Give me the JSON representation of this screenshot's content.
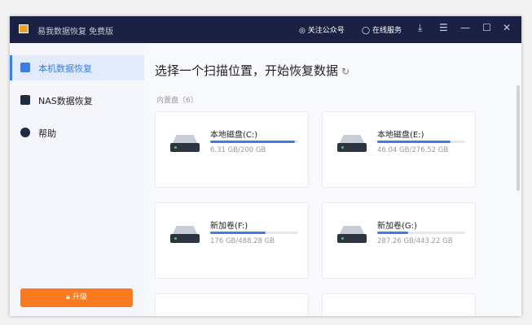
{
  "titlebar": {
    "app_title": "易我数据恢复 免费版",
    "follow": "关注公众号",
    "service": "在线服务"
  },
  "sidebar": {
    "items": [
      {
        "label": "本机数据恢复"
      },
      {
        "label": "NAS数据恢复"
      },
      {
        "label": "帮助"
      }
    ],
    "upgrade": "升级"
  },
  "main": {
    "title": "选择一个扫描位置，开始恢复数据",
    "section": "内置盘（6）",
    "drives": [
      {
        "name": "本地磁盘(C:)",
        "size": "6.31 GB/200 GB",
        "fill": 0.96
      },
      {
        "name": "本地磁盘(E:)",
        "size": "46.04 GB/276.52 GB",
        "fill": 0.83
      },
      {
        "name": "新加卷(F:)",
        "size": "176 GB/488.28 GB",
        "fill": 0.63
      },
      {
        "name": "新加卷(G:)",
        "size": "287.26 GB/443.22 GB",
        "fill": 0.35
      }
    ]
  },
  "colors": {
    "titlebar": "#1b2143",
    "accent": "#3a7ee6",
    "upgrade": "#f97a1f"
  }
}
